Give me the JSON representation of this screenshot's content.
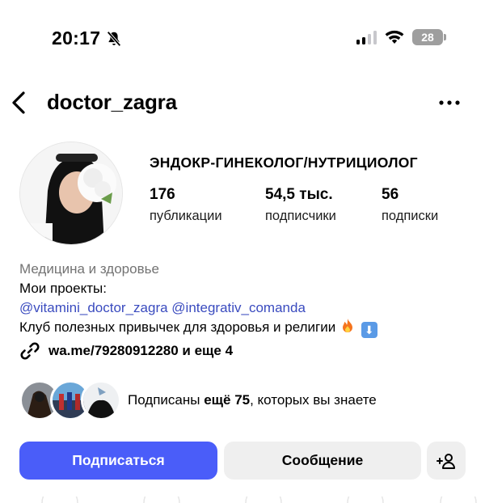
{
  "status_bar": {
    "time": "20:17",
    "battery": "28"
  },
  "header": {
    "username": "doctor_zagra"
  },
  "profile": {
    "category_title": "ЭНДОКР-ГИНЕКОЛОГ/НУТРИЦИОЛОГ",
    "stats": [
      {
        "value": "176",
        "label": "публикации"
      },
      {
        "value": "54,5 тыс.",
        "label": "подписчики"
      },
      {
        "value": "56",
        "label": "подписки"
      }
    ],
    "category": "Медицина и здоровье",
    "bio_line1": "Мои проекты:",
    "bio_links": "@vitamini_doctor_zagra @integrativ_comanda",
    "bio_line3": "Клуб полезных привычек для здоровья и религии",
    "external_link": "wa.me/79280912280 и еще 4"
  },
  "mutuals": {
    "prefix": "Подписаны ",
    "count": "ещё 75",
    "suffix": ", которых вы знаете"
  },
  "actions": {
    "follow": "Подписаться",
    "message": "Сообщение"
  },
  "colors": {
    "accent": "#4a5df9",
    "link": "#3a4bbf",
    "secondary_button": "#efefef"
  }
}
